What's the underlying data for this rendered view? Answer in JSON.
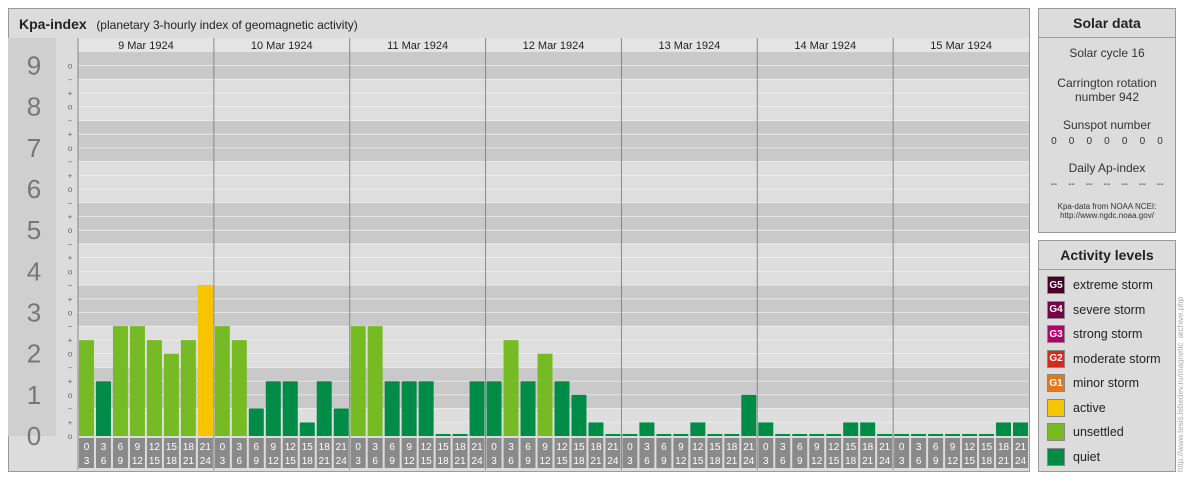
{
  "title": "Kpa-index",
  "subtitle": "(planetary 3-hourly index of geomagnetic activity)",
  "solar": {
    "heading": "Solar data",
    "cycle": "Solar cycle 16",
    "carrington_1": "Carrington rotation",
    "carrington_2": "number 942",
    "sunspot_label": "Sunspot number",
    "sunspot_values": [
      "0",
      "0",
      "0",
      "0",
      "0",
      "0",
      "0"
    ],
    "ap_label": "Daily Ap-index",
    "ap_values": [
      "--",
      "--",
      "--",
      "--",
      "--",
      "--",
      "--"
    ],
    "source_1": "Kpa-data from NOAA NCEI:",
    "source_2": "http://www.ngdc.noaa.gov/"
  },
  "legend": {
    "heading": "Activity levels",
    "items": [
      {
        "badge": "G5",
        "label": "extreme storm",
        "color": "#4a0026"
      },
      {
        "badge": "G4",
        "label": "severe storm",
        "color": "#7a0046"
      },
      {
        "badge": "G3",
        "label": "strong storm",
        "color": "#b5006a"
      },
      {
        "badge": "G2",
        "label": "moderate storm",
        "color": "#d42c1c"
      },
      {
        "badge": "G1",
        "label": "minor storm",
        "color": "#e67817"
      },
      {
        "badge": "",
        "label": "active",
        "color": "#f7c500"
      },
      {
        "badge": "",
        "label": "unsettled",
        "color": "#76bb24"
      },
      {
        "badge": "",
        "label": "quiet",
        "color": "#008b47"
      }
    ]
  },
  "watermark": "http://www.tesis.lebedev.ru/magnetic_archive.php",
  "chart_data": {
    "type": "bar",
    "y_axis_labels": [
      "0",
      "1",
      "2",
      "3",
      "4",
      "5",
      "6",
      "7",
      "8",
      "9"
    ],
    "sub_marks": [
      "o",
      "+",
      "−"
    ],
    "ylim": [
      0,
      9.33
    ],
    "days": [
      "9 Mar 1924",
      "10 Mar 1924",
      "11 Mar 1924",
      "12 Mar 1924",
      "13 Mar 1924",
      "14 Mar 1924",
      "15 Mar 1924"
    ],
    "interval_starts": [
      "0",
      "3",
      "6",
      "9",
      "12",
      "15",
      "18",
      "21"
    ],
    "interval_ends": [
      "3",
      "6",
      "9",
      "12",
      "15",
      "18",
      "21",
      "24"
    ],
    "values": [
      [
        2.33,
        1.33,
        2.67,
        2.67,
        2.33,
        2.0,
        2.33,
        3.67
      ],
      [
        2.67,
        2.33,
        0.67,
        1.33,
        1.33,
        0.33,
        1.33,
        0.67
      ],
      [
        2.67,
        2.67,
        1.33,
        1.33,
        1.33,
        0.0,
        0.0,
        1.33
      ],
      [
        1.33,
        2.33,
        1.33,
        2.0,
        1.33,
        1.0,
        0.33,
        0.0
      ],
      [
        0.0,
        0.33,
        0.0,
        0.0,
        0.33,
        0.0,
        0.0,
        1.0
      ],
      [
        0.33,
        0.0,
        0.0,
        0.0,
        0.0,
        0.33,
        0.33,
        0.0
      ],
      [
        0.0,
        0.0,
        0.0,
        0.0,
        0.0,
        0.0,
        0.33,
        0.33
      ]
    ],
    "colors": {
      "quiet": "#008b47",
      "unsettled": "#76bb24",
      "active": "#f7c500"
    }
  }
}
